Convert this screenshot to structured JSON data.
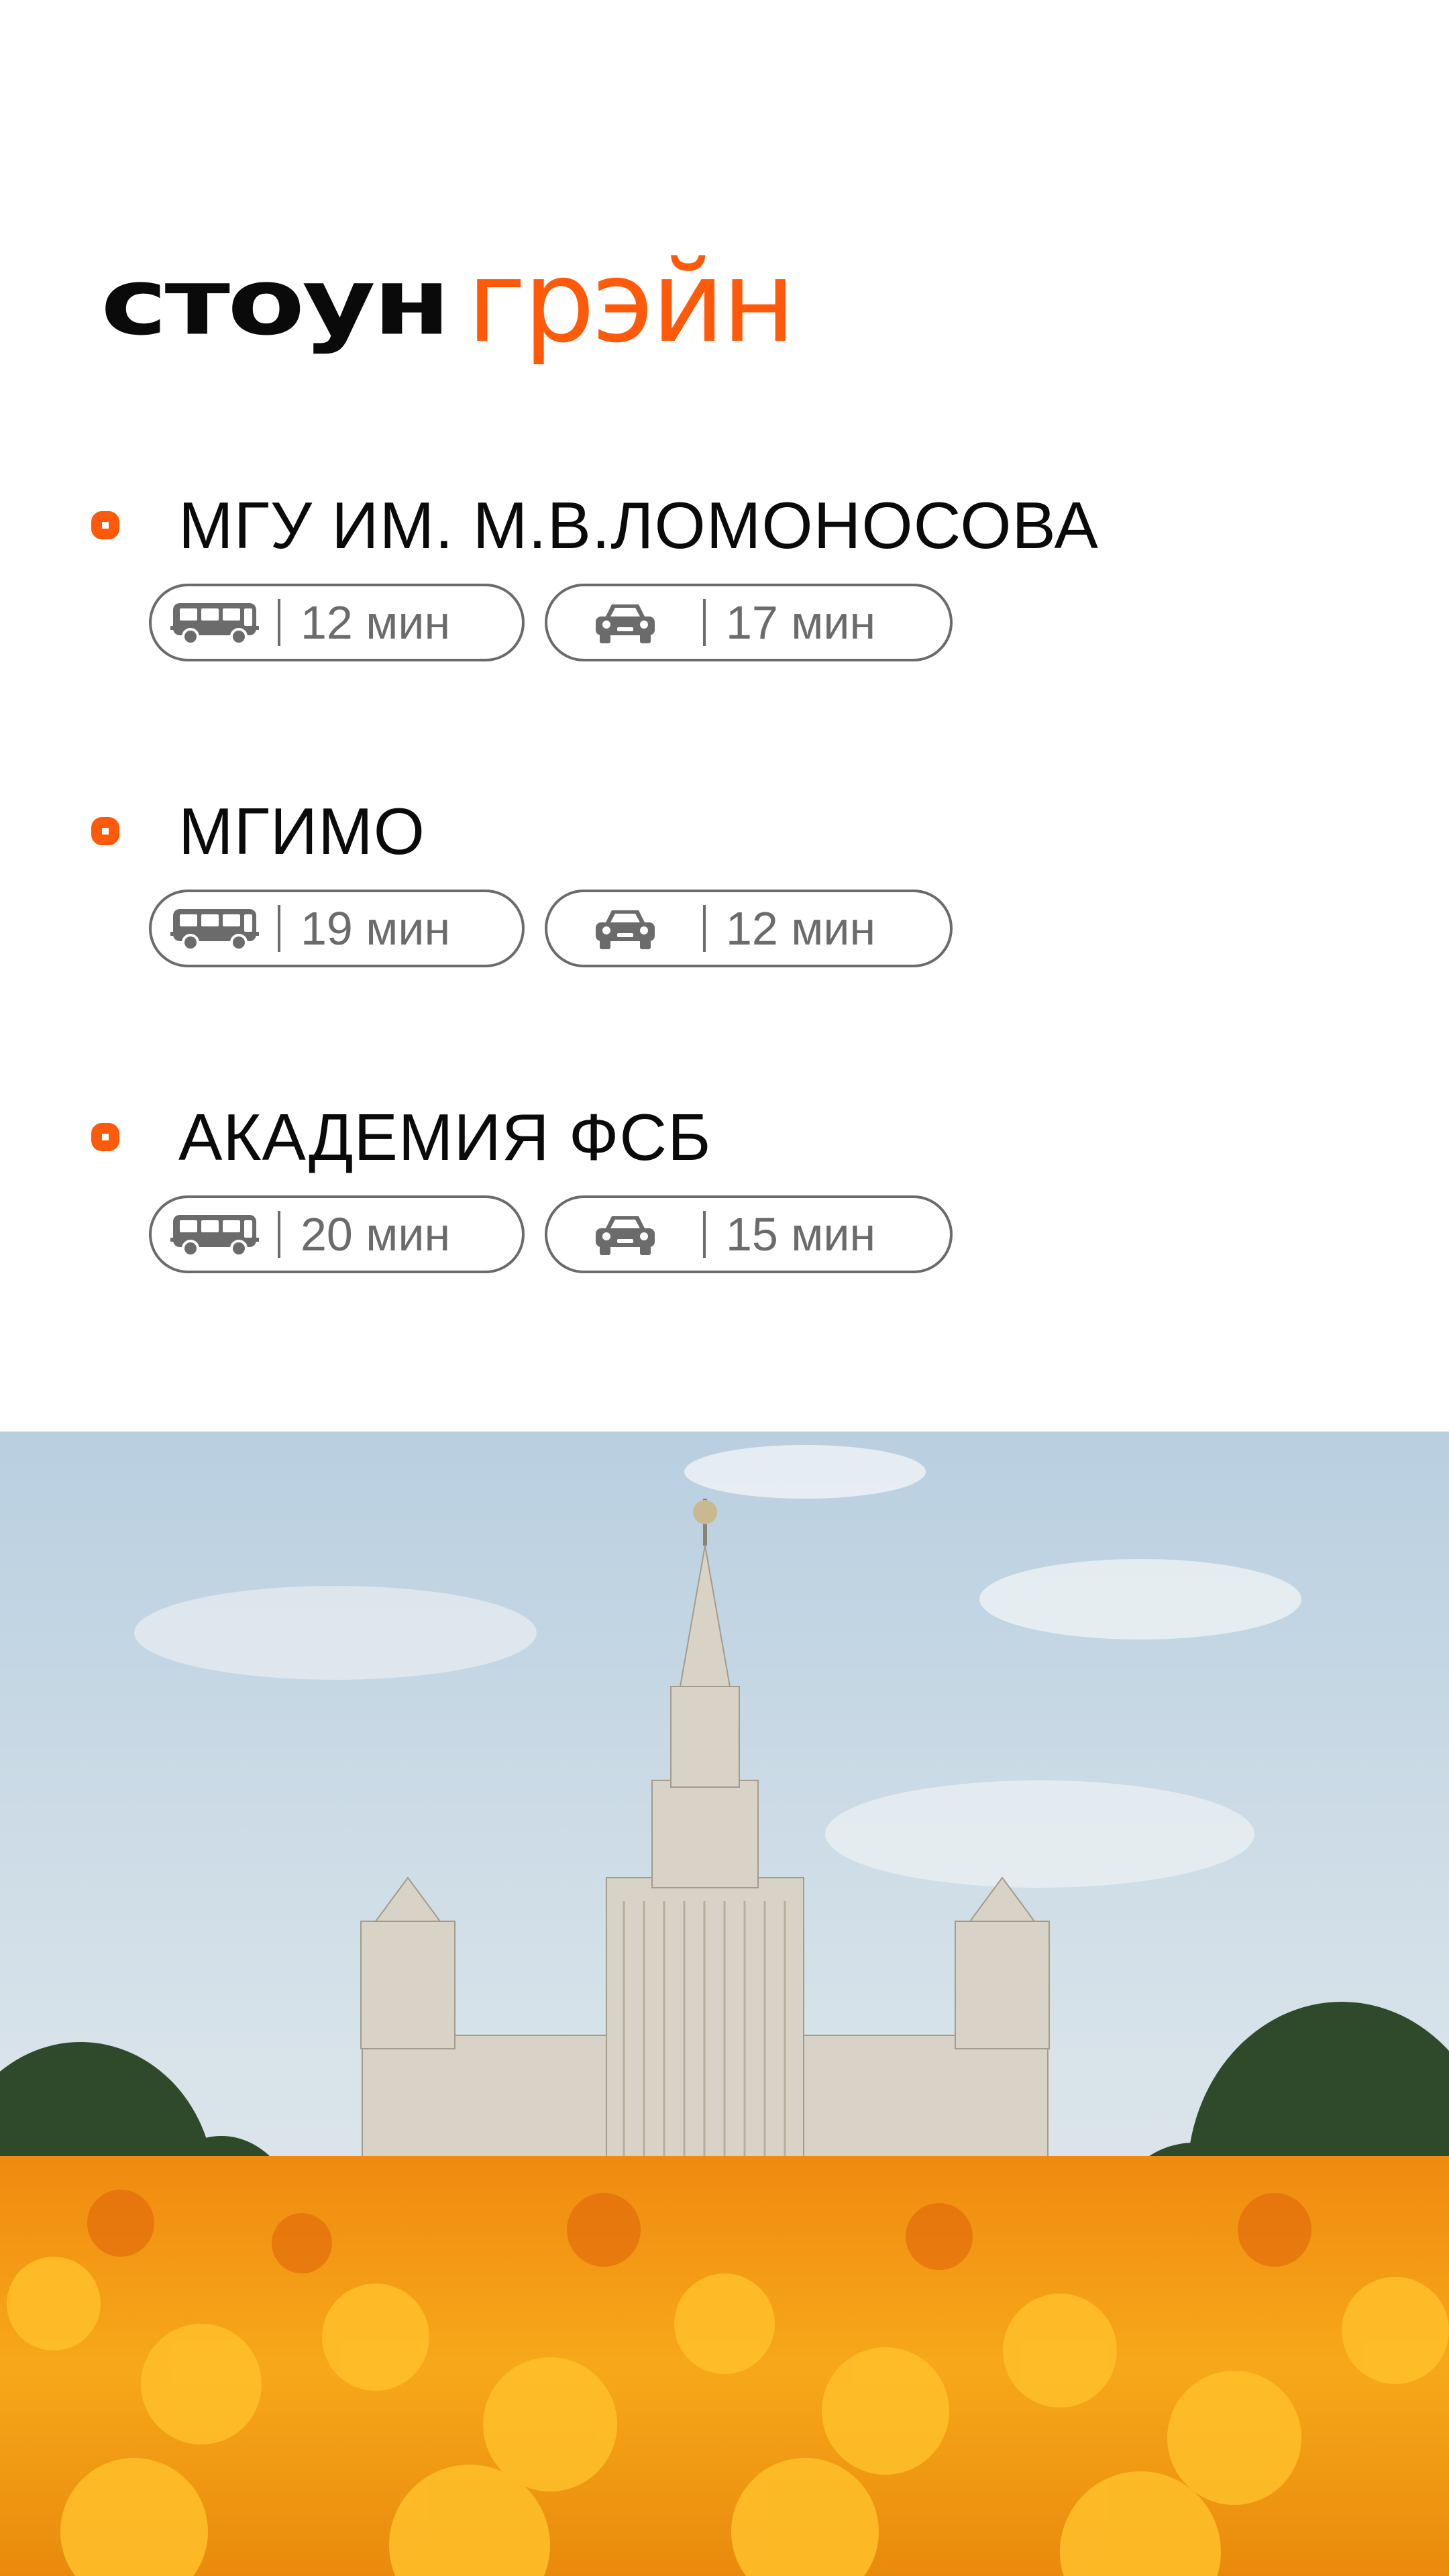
{
  "brand": {
    "word1": "стоун",
    "word2": "грэйн",
    "accent": "#ff5a0a"
  },
  "destinations": [
    {
      "name": "МГУ ИМ. М.В.ЛОМОНОСОВА",
      "bus_time": "12 мин",
      "car_time": "17 мин"
    },
    {
      "name": "МГИМО",
      "bus_time": "19 мин",
      "car_time": "12 мин"
    },
    {
      "name": "АКАДЕМИЯ ФСБ",
      "bus_time": "20 мин",
      "car_time": "15 мин"
    }
  ],
  "icons": {
    "transit": "bus-icon",
    "drive": "car-icon",
    "bullet": "square-bullet-icon"
  }
}
